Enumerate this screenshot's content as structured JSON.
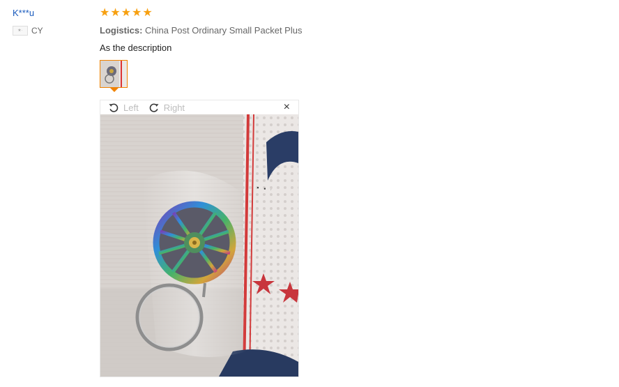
{
  "reviewer": {
    "name": "K***u",
    "country_code": "CY"
  },
  "review": {
    "rating": 5,
    "stars": [
      "★",
      "★",
      "★",
      "★",
      "★"
    ],
    "logistics_label": "Logistics:",
    "logistics_value": "China Post Ordinary Small Packet Plus",
    "text": "As the description"
  },
  "viewer": {
    "rotate_left_label": "Left",
    "rotate_right_label": "Right",
    "close_symbol": "×"
  },
  "colors": {
    "accent": "#f08200",
    "star": "#f7a010",
    "username": "#1a5bbd"
  }
}
